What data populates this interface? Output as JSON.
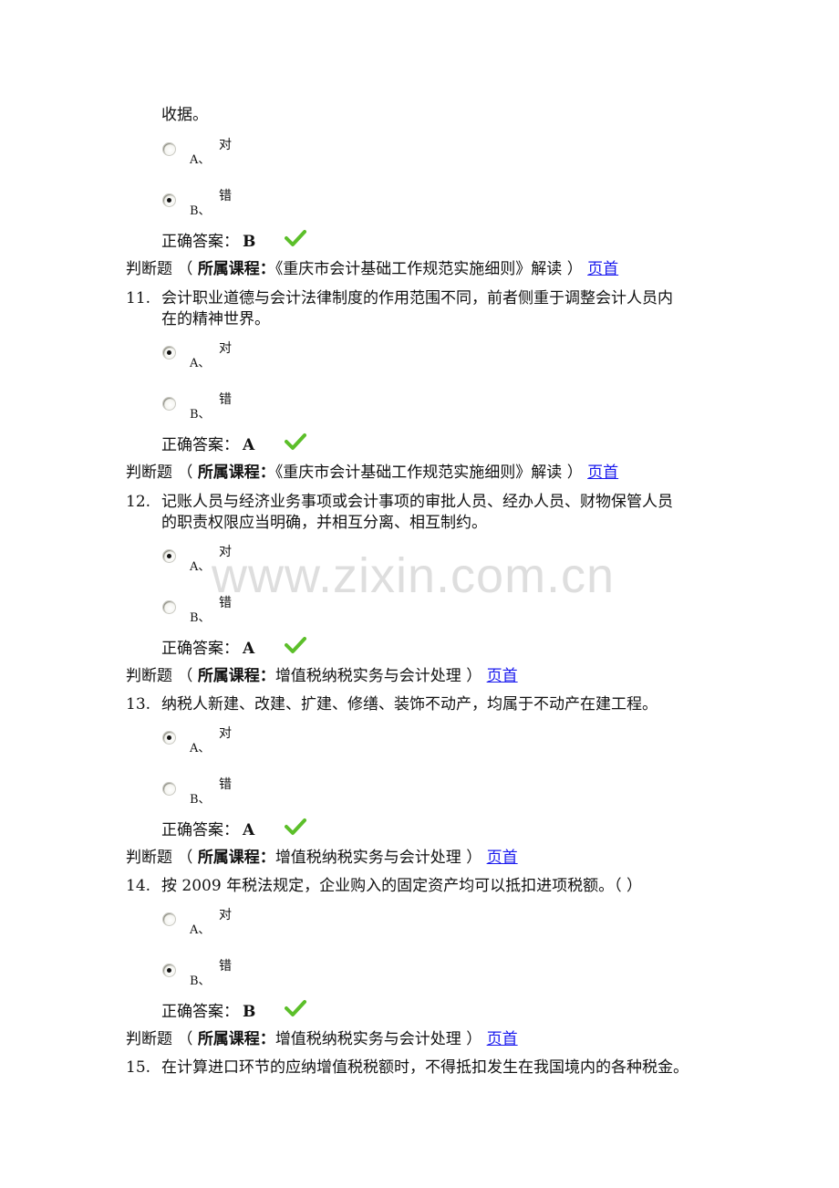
{
  "watermark": "www.zixin.com.cn",
  "top_fragment": "收据。",
  "labels": {
    "type": "判断题",
    "open_paren": "（",
    "course_label": "所属课程：",
    "close_paren": "）",
    "home_link": "页首",
    "answer_label": "正确答案："
  },
  "option_letters": [
    "A、",
    "B、"
  ],
  "option_texts": [
    "对",
    "错"
  ],
  "items": [
    {
      "course": "《重庆市会计基础工作规范实施细则》解读",
      "number": "11.",
      "question_lines": [
        "会计职业道德与会计法律制度的作用范围不同，前者侧重于调整会计人员内",
        "在的精神世界。"
      ],
      "selected": "A",
      "answer": "A"
    },
    {
      "course": "《重庆市会计基础工作规范实施细则》解读",
      "number": "12.",
      "question_lines": [
        "记账人员与经济业务事项或会计事项的审批人员、经办人员、财物保管人员",
        "的职责权限应当明确，并相互分离、相互制约。"
      ],
      "selected": "A",
      "answer": "A"
    },
    {
      "course": "增值税纳税实务与会计处理",
      "number": "13.",
      "question_lines": [
        "纳税人新建、改建、扩建、修缮、装饰不动产，均属于不动产在建工程。"
      ],
      "selected": "A",
      "answer": "A"
    },
    {
      "course": "增值税纳税实务与会计处理",
      "number": "14.",
      "question_lines": [
        "按 2009 年税法规定，企业购入的固定资产均可以抵扣进项税额。（ ）"
      ],
      "selected": "B",
      "answer": "B"
    },
    {
      "course": "增值税纳税实务与会计处理",
      "number": "15.",
      "question_lines": [
        "在计算进口环节的应纳增值税税额时，不得抵扣发生在我国境内的各种税金。"
      ]
    }
  ],
  "prev_item": {
    "selected": "B",
    "answer": "B"
  },
  "colors": {
    "link": "#1a1aee",
    "check": "#5cbf2a",
    "text": "#111111"
  }
}
